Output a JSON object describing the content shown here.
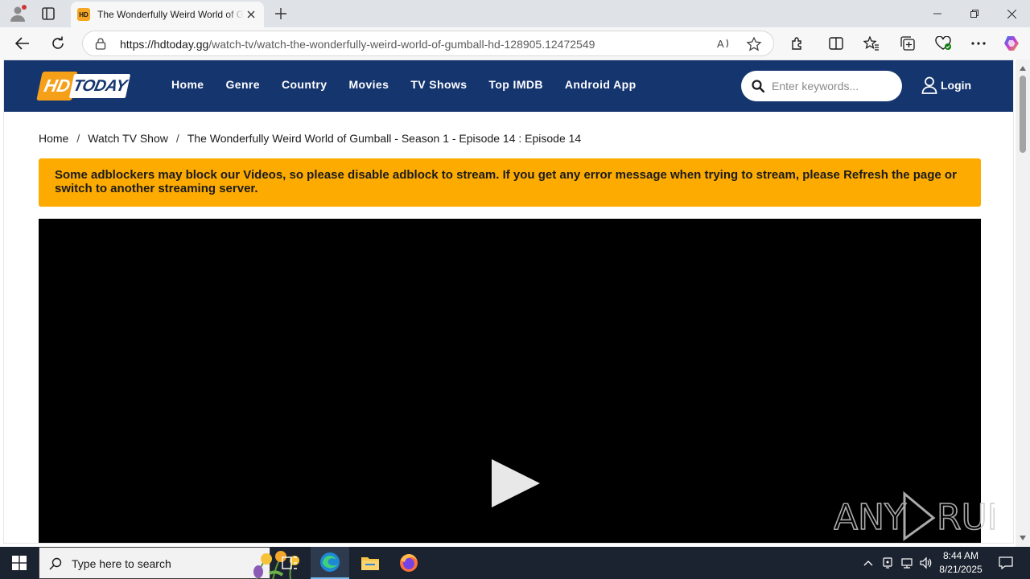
{
  "browser": {
    "tab_title": "The Wonderfully Weird World of Gumball",
    "tab_favicon_text": "HD",
    "url_domain": "https://hdtoday.gg",
    "url_path": "/watch-tv/watch-the-wonderfully-weird-world-of-gumball-hd-128905.12472549"
  },
  "site": {
    "logo_hd": "HD",
    "logo_today": "TODAY",
    "nav": [
      "Home",
      "Genre",
      "Country",
      "Movies",
      "TV Shows",
      "Top IMDB",
      "Android App"
    ],
    "search_placeholder": "Enter keywords...",
    "login_label": "Login",
    "breadcrumb": {
      "home": "Home",
      "section": "Watch TV Show",
      "current": "The Wonderfully Weird World of Gumball - Season 1 - Episode 14 : Episode 14",
      "separator": "/"
    },
    "warning": "Some adblockers may block our Videos, so please disable adblock to stream. If you get any error message when trying to stream, please Refresh the page or switch to another streaming server.",
    "colors": {
      "nav_bg": "#15356f",
      "warning_bg": "#fdab00",
      "logo_accent": "#f6a01a"
    }
  },
  "taskbar": {
    "search_placeholder": "Type here to search",
    "time": "8:44 AM",
    "date": "8/21/2025"
  },
  "watermark": "ANY RUN"
}
